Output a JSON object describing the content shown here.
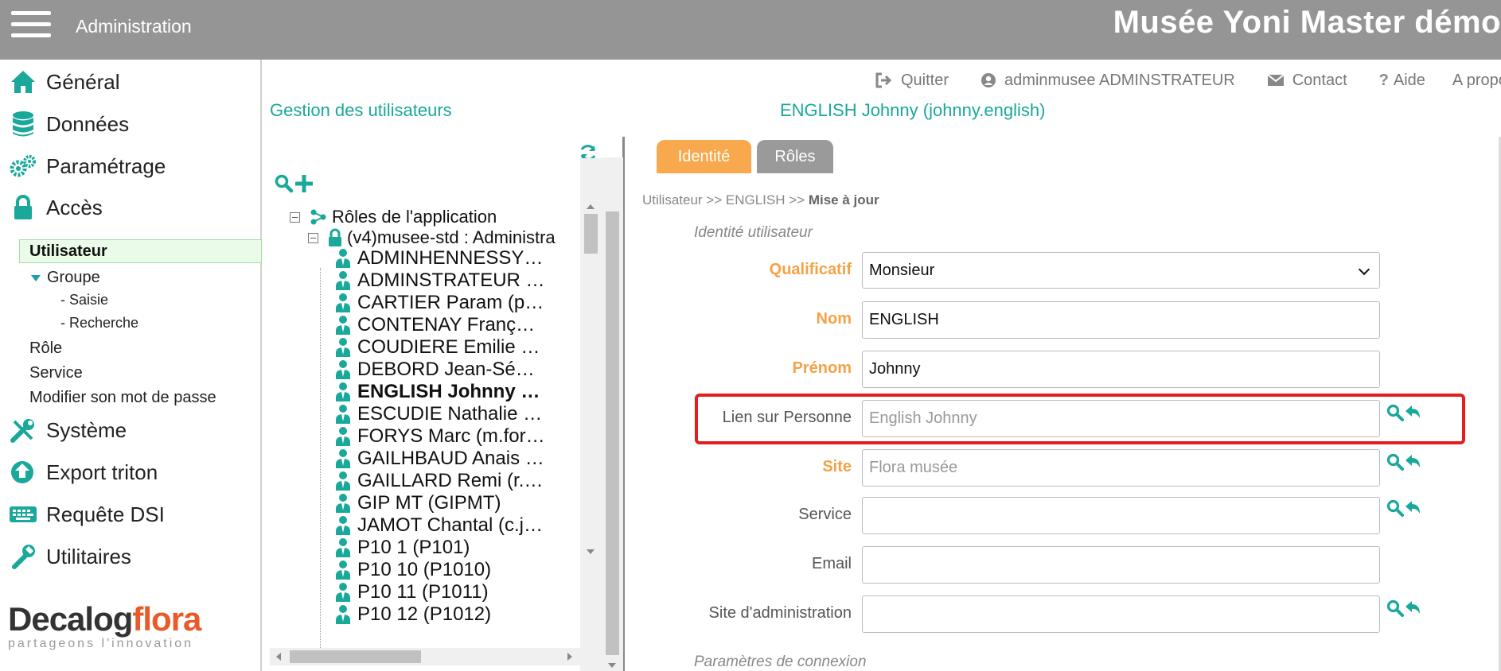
{
  "header": {
    "app_label": "Administration",
    "brand": "Musée Yoni Master démo"
  },
  "sidebar": {
    "items": [
      {
        "label": "Général",
        "icon": "home-icon"
      },
      {
        "label": "Données",
        "icon": "database-icon"
      },
      {
        "label": "Paramétrage",
        "icon": "gears-icon"
      },
      {
        "label": "Accès",
        "icon": "lock-icon"
      },
      {
        "label": "Système",
        "icon": "tools-icon"
      },
      {
        "label": "Export triton",
        "icon": "export-icon"
      },
      {
        "label": "Requête DSI",
        "icon": "keyboard-icon"
      },
      {
        "label": "Utilitaires",
        "icon": "wrench-icon"
      }
    ],
    "sub": {
      "utilisateur": "Utilisateur",
      "groupe": "Groupe",
      "saisie": "- Saisie",
      "recherche": "- Recherche",
      "role": "Rôle",
      "service": "Service",
      "modifier_mdp": "Modifier son mot de passe"
    },
    "logo": {
      "part1": "Decalog",
      "part2": "flora",
      "tagline": "partageons l'innovation"
    }
  },
  "toplinks": {
    "quitter": "Quitter",
    "user": "adminmusee ADMINSTRATEUR",
    "contact": "Contact",
    "aide": "Aide",
    "apropos": "A propos"
  },
  "breadcrumbs": {
    "left": "Gestion des utilisateurs",
    "right": "ENGLISH Johnny (johnny.english)"
  },
  "tree": {
    "root": "Rôles de l'application",
    "role": "(v4)musee-std : Administra",
    "users": [
      "ADMINHENNESSY…",
      "ADMINSTRATEUR …",
      "CARTIER Param (p…",
      "CONTENAY Franç…",
      "COUDIERE Emilie …",
      "DEBORD Jean-Sé…",
      "ENGLISH Johnny …",
      "ESCUDIE Nathalie …",
      "FORYS Marc (m.for…",
      "GAILHBAUD Anais …",
      "GAILLARD Remi (r.…",
      "GIP MT (GIPMT)",
      "JAMOT Chantal (c.j…",
      "P10 1 (P101)",
      "P10 10 (P1010)",
      "P10 11 (P1011)",
      "P10 12 (P1012)"
    ],
    "selected_index": 6
  },
  "form": {
    "tabs": {
      "identite": "Identité",
      "roles": "Rôles"
    },
    "crumb_a": "Utilisateur >> ENGLISH >> ",
    "crumb_b": "Mise à jour",
    "section1": "Identité utilisateur",
    "section2": "Paramètres de connexion",
    "fields": {
      "qualificatif": {
        "label": "Qualificatif",
        "value": "Monsieur"
      },
      "nom": {
        "label": "Nom",
        "value": "ENGLISH"
      },
      "prenom": {
        "label": "Prénom",
        "value": "Johnny"
      },
      "lien": {
        "label": "Lien sur Personne",
        "value": "English Johnny"
      },
      "site": {
        "label": "Site",
        "value": "Flora musée"
      },
      "service": {
        "label": "Service",
        "value": ""
      },
      "email": {
        "label": "Email",
        "value": ""
      },
      "site_admin": {
        "label": "Site d'administration",
        "value": ""
      }
    }
  },
  "colors": {
    "header_bg": "#959595",
    "accent_green": "#19a89a",
    "tab_active": "#f8a94d",
    "tab_inactive": "#9a9a9a",
    "required_label": "#f4a245",
    "highlight": "#e21e1e"
  }
}
